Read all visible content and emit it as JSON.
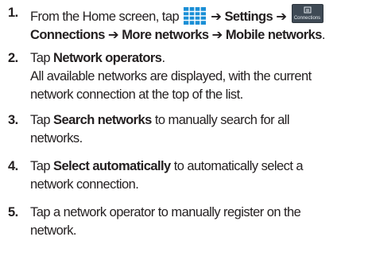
{
  "steps": [
    {
      "number": "1.",
      "line1": {
        "prefix": "From the Home screen, tap ",
        "arrow1": " ➔ ",
        "settings": "Settings",
        "arrow2": " ➔ "
      },
      "line2": {
        "connections": "Connections",
        "arrow3": " ➔ ",
        "more_networks": "More networks",
        "arrow4": " ➔ ",
        "mobile_networks": "Mobile networks",
        "end": "."
      },
      "icons": {
        "apps": "apps-grid-icon",
        "connections": "connections-tab-icon",
        "connections_icon_label": "Connections"
      }
    },
    {
      "number": "2.",
      "text_prefix": "Tap ",
      "bold": "Network operators",
      "text_suffix": ".",
      "note_line1": "All available networks are displayed, with the current",
      "note_line2": "network connection at the top of the list."
    },
    {
      "number": "3.",
      "text_prefix": "Tap ",
      "bold": "Search networks",
      "line1_suffix": " to manually search for all",
      "line2": "networks."
    },
    {
      "number": "4.",
      "text_prefix": "Tap ",
      "bold": "Select automatically",
      "line1_suffix": " to automatically select a",
      "line2": "network connection."
    },
    {
      "number": "5.",
      "line1": "Tap a network operator to manually register on the",
      "line2": "network."
    }
  ],
  "colors": {
    "text": "#231f20",
    "apps_icon": "#1a8fd6",
    "connections_icon_bg": "#3f4a55"
  }
}
